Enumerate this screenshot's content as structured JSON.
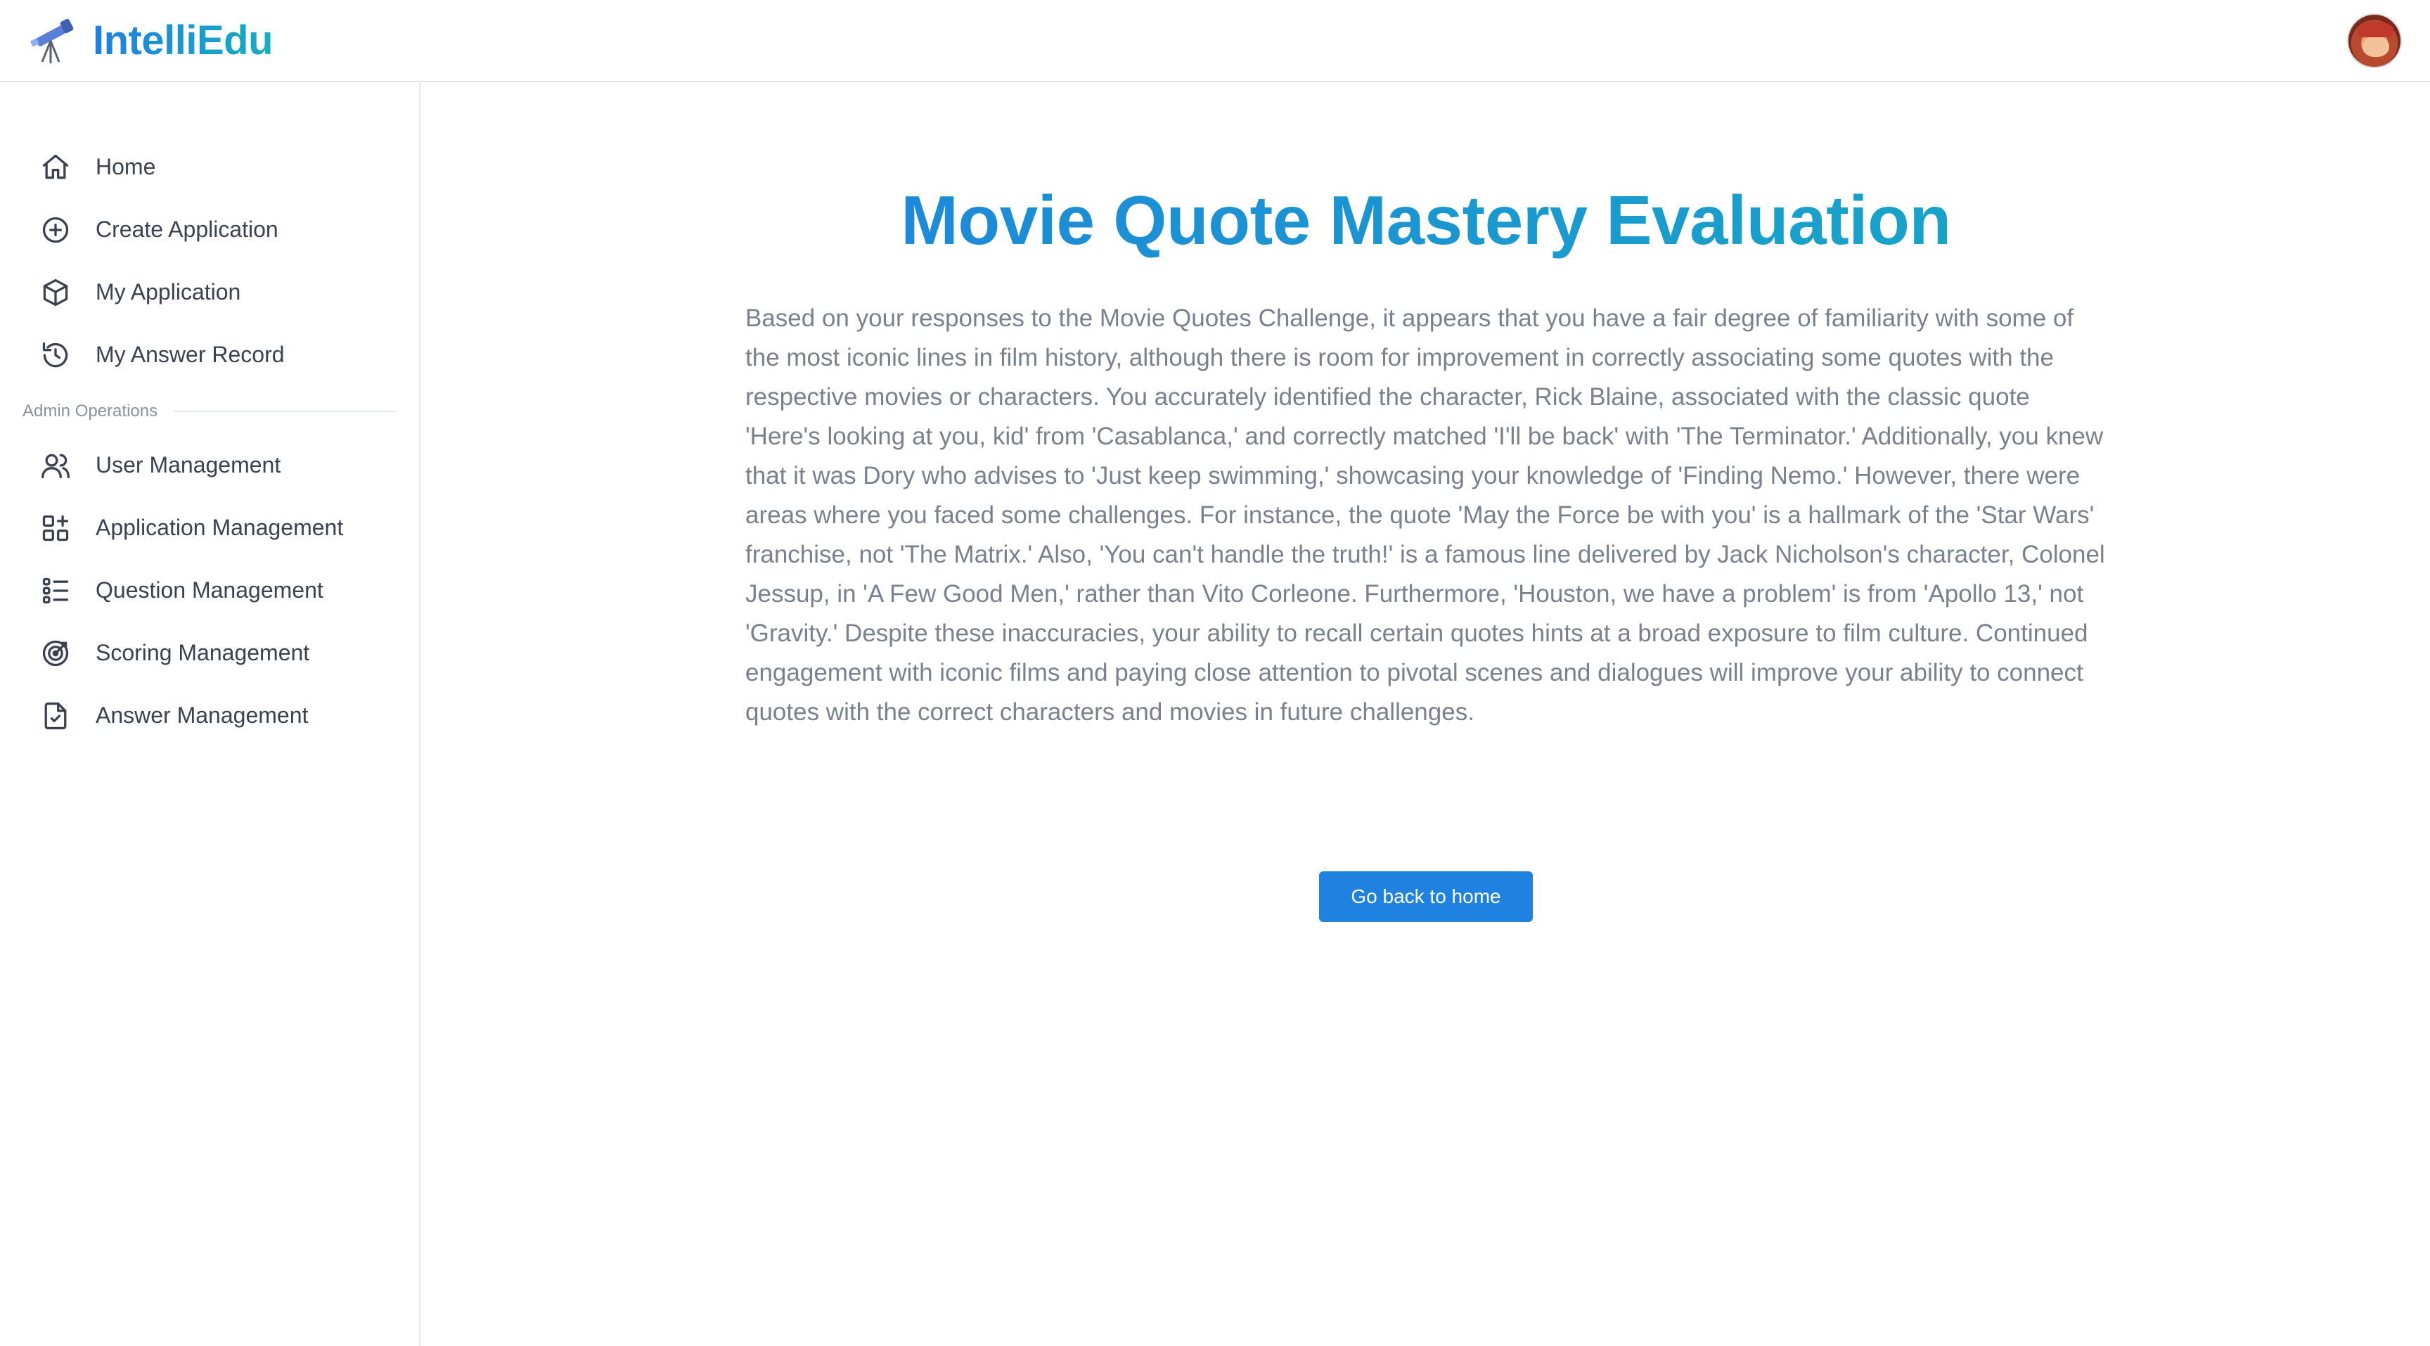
{
  "app": {
    "name": "IntelliEdu",
    "logo_icon": "telescope-icon",
    "accent_colors": [
      "#1f7fe0",
      "#16aec2"
    ]
  },
  "sidebar": {
    "items": [
      {
        "label": "Home",
        "icon": "home-icon"
      },
      {
        "label": "Create Application",
        "icon": "plus-circle-icon"
      },
      {
        "label": "My Application",
        "icon": "box-icon"
      },
      {
        "label": "My Answer Record",
        "icon": "history-icon"
      }
    ],
    "admin_section_label": "Admin Operations",
    "admin_items": [
      {
        "label": "User Management",
        "icon": "users-icon"
      },
      {
        "label": "Application Management",
        "icon": "grid-plus-icon"
      },
      {
        "label": "Question Management",
        "icon": "list-check-icon"
      },
      {
        "label": "Scoring Management",
        "icon": "target-icon"
      },
      {
        "label": "Answer Management",
        "icon": "file-check-icon"
      }
    ]
  },
  "main": {
    "title": "Movie Quote Mastery Evaluation",
    "description": "Based on your responses to the Movie Quotes Challenge, it appears that you have a fair degree of familiarity with some of the most iconic lines in film history, although there is room for improvement in correctly associating some quotes with the respective movies or characters. You accurately identified the character, Rick Blaine, associated with the classic quote 'Here's looking at you, kid' from 'Casablanca,' and correctly matched 'I'll be back' with 'The Terminator.' Additionally, you knew that it was Dory who advises to 'Just keep swimming,' showcasing your knowledge of 'Finding Nemo.' However, there were areas where you faced some challenges. For instance, the quote 'May the Force be with you' is a hallmark of the 'Star Wars' franchise, not 'The Matrix.' Also, 'You can't handle the truth!' is a famous line delivered by Jack Nicholson's character, Colonel Jessup, in 'A Few Good Men,' rather than Vito Corleone. Furthermore, 'Houston, we have a problem' is from 'Apollo 13,' not 'Gravity.' Despite these inaccuracies, your ability to recall certain quotes hints at a broad exposure to film culture. Continued engagement with iconic films and paying close attention to pivotal scenes and dialogues will improve your ability to connect quotes with the correct characters and movies in future challenges.",
    "button_label": "Go back to home"
  }
}
